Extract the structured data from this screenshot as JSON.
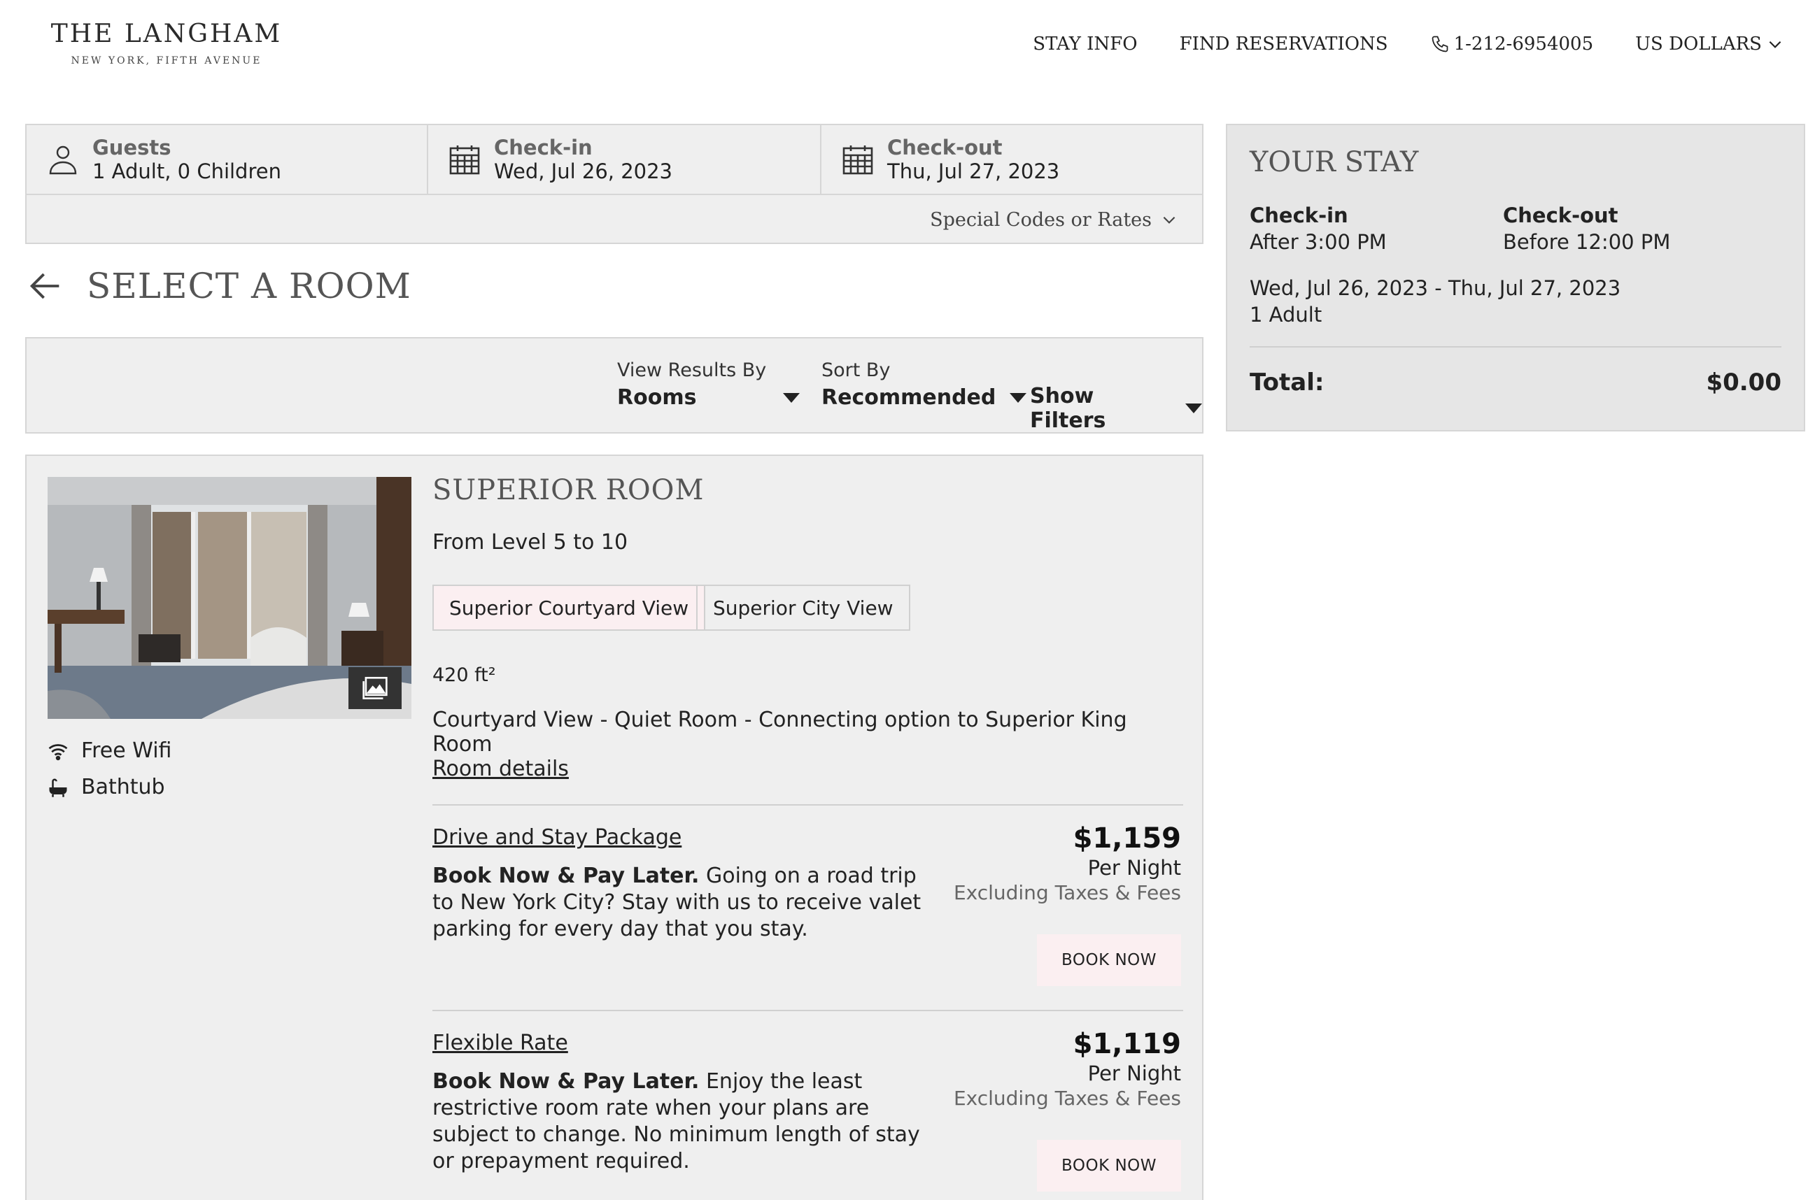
{
  "brand": {
    "name": "THE LANGHAM",
    "location": "NEW YORK, FIFTH AVENUE"
  },
  "nav": {
    "stay_info": "STAY INFO",
    "find_reservations": "FIND RESERVATIONS",
    "phone": "1-212-6954005",
    "currency": "US DOLLARS"
  },
  "search": {
    "guests_label": "Guests",
    "guests_value": "1 Adult, 0 Children",
    "checkin_label": "Check-in",
    "checkin_value": "Wed, Jul 26, 2023",
    "checkout_label": "Check-out",
    "checkout_value": "Thu, Jul 27, 2023",
    "special_codes": "Special Codes or Rates"
  },
  "page_title": "SELECT A ROOM",
  "filters": {
    "view_label": "View Results By",
    "view_value": "Rooms",
    "sort_label": "Sort By",
    "sort_value": "Recommended",
    "show_filters": "Show Filters"
  },
  "your_stay": {
    "title": "YOUR STAY",
    "checkin_label": "Check-in",
    "checkin_value": "After 3:00 PM",
    "checkout_label": "Check-out",
    "checkout_value": "Before 12:00 PM",
    "dates": "Wed, Jul 26, 2023 - Thu, Jul 27, 2023",
    "guests": "1 Adult",
    "total_label": "Total:",
    "total_value": "$0.00"
  },
  "room": {
    "name": "SUPERIOR ROOM",
    "levels": "From Level 5 to 10",
    "views": [
      "Superior Courtyard View",
      "Superior City View"
    ],
    "size": "420 ft²",
    "description": "Courtyard View - Quiet Room - Connecting option to Superior King Room",
    "details_link": "Room details",
    "amenities": [
      "Free Wifi",
      "Bathtub"
    ],
    "rates": [
      {
        "name": "Drive and Stay Package",
        "bold": "Book Now & Pay Later.",
        "text": " Going on a road trip to New York City? Stay with us to receive valet parking for every day that you stay.",
        "price": "$1,159",
        "per": "Per Night",
        "excl": "Excluding Taxes & Fees",
        "cta": "BOOK NOW"
      },
      {
        "name": "Flexible Rate",
        "bold": "Book Now & Pay Later.",
        "text": " Enjoy the least restrictive room rate when your plans are subject to change. No minimum length of stay or prepayment required.",
        "price": "$1,119",
        "per": "Per Night",
        "excl": "Excluding Taxes & Fees",
        "cta": "BOOK NOW"
      }
    ]
  },
  "colors": {
    "panel_bg": "#efefef",
    "stay_bg": "#e6e6e6",
    "accent_pink": "#fbeff1",
    "border": "#d6d6d6"
  }
}
